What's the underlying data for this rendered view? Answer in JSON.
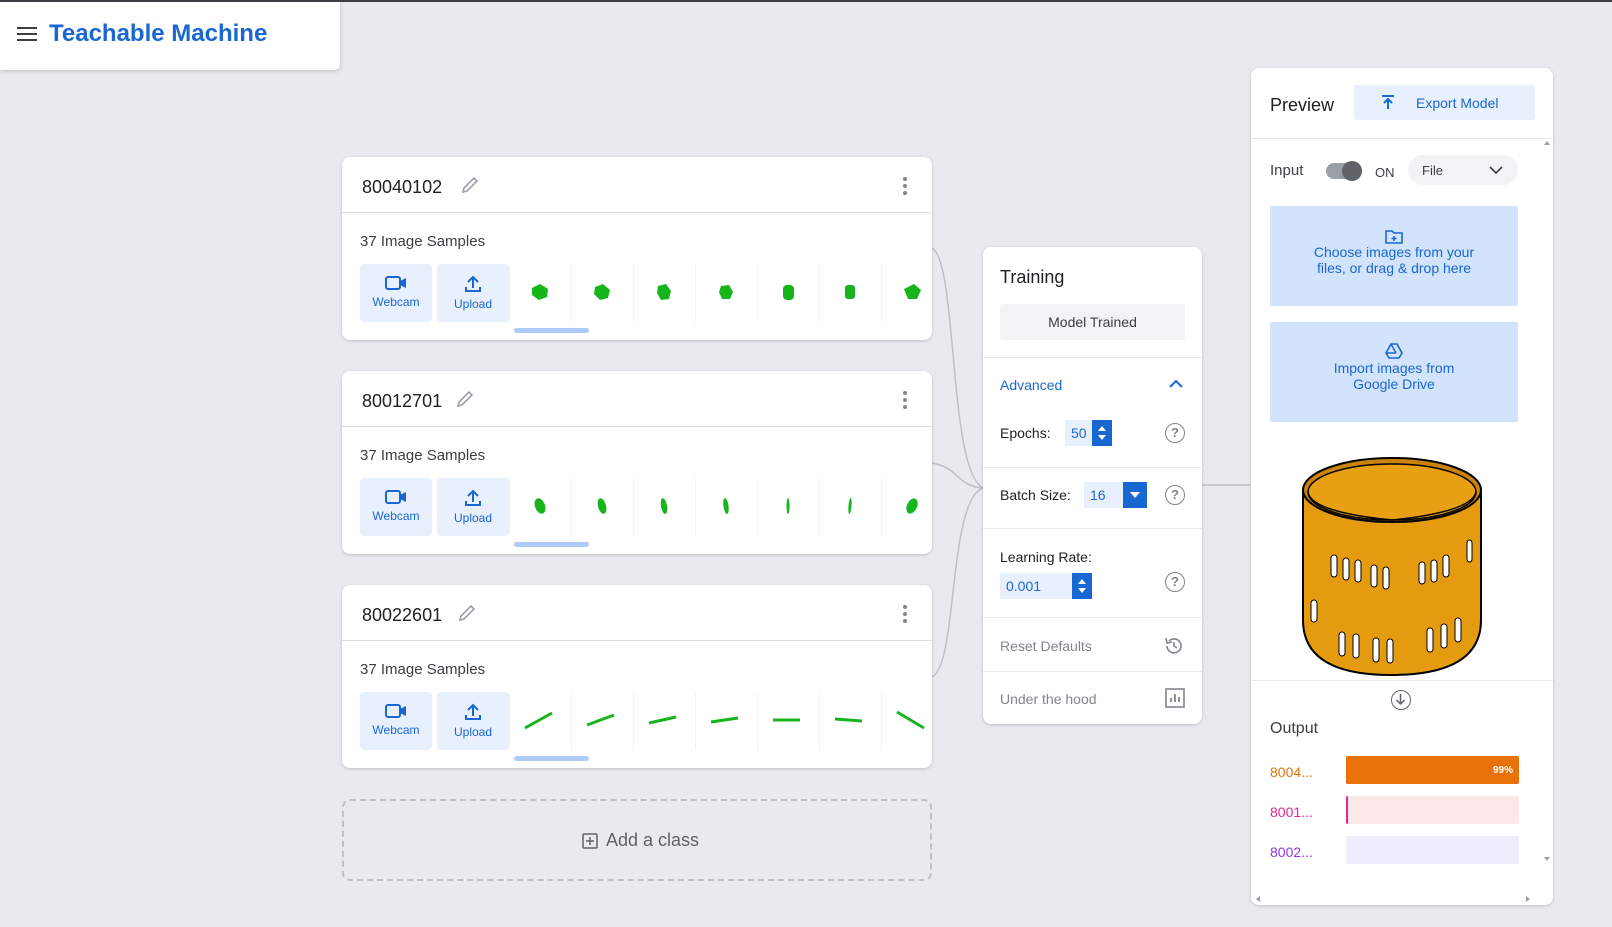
{
  "app": {
    "title": "Teachable Machine"
  },
  "classes": [
    {
      "name": "80040102",
      "samples_label": "37 Image Samples",
      "webcam_label": "Webcam",
      "upload_label": "Upload"
    },
    {
      "name": "80012701",
      "samples_label": "37 Image Samples",
      "webcam_label": "Webcam",
      "upload_label": "Upload"
    },
    {
      "name": "80022601",
      "samples_label": "37 Image Samples",
      "webcam_label": "Webcam",
      "upload_label": "Upload"
    }
  ],
  "add_class_label": "Add a class",
  "training": {
    "title": "Training",
    "status_button": "Model Trained",
    "advanced_label": "Advanced",
    "epochs_label": "Epochs:",
    "epochs_value": "50",
    "batch_label": "Batch Size:",
    "batch_value": "16",
    "lr_label": "Learning Rate:",
    "lr_value": "0.001",
    "reset_label": "Reset Defaults",
    "hood_label": "Under the hood"
  },
  "preview": {
    "title": "Preview",
    "export_label": "Export Model",
    "input_label": "Input",
    "toggle_state": "ON",
    "source_value": "File",
    "choose_line1": "Choose images from your",
    "choose_line2": "files, or drag & drop here",
    "drive_line1": "Import images from",
    "drive_line2": "Google Drive",
    "output_title": "Output",
    "outputs": [
      {
        "label": "8004...",
        "value": 0.99,
        "pct_text": "99%",
        "color": "#e8710a",
        "track": "#e8710a"
      },
      {
        "label": "8001...",
        "value": 0.005,
        "pct_text": "",
        "color": "#e52592",
        "track": "#fce8e9"
      },
      {
        "label": "8002...",
        "value": 0.0,
        "pct_text": "",
        "color": "#9334e6",
        "track": "#efedfd"
      }
    ]
  },
  "colors": {
    "accent": "#1967d2",
    "accent_light": "#e8f0fe",
    "sample_green": "#17b51c"
  }
}
